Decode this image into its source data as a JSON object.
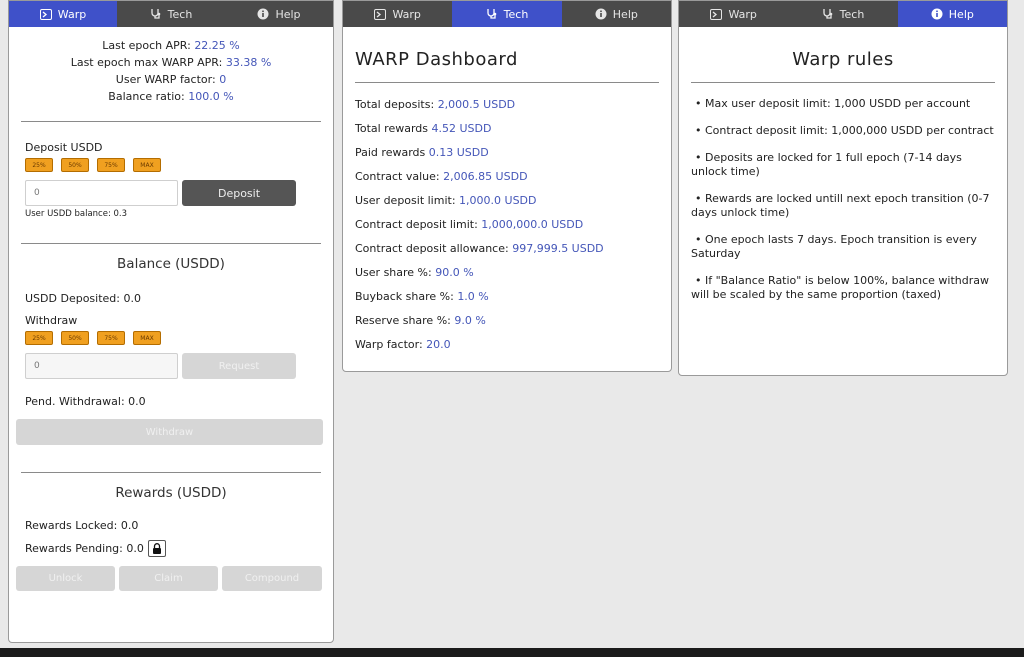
{
  "tabs": [
    {
      "label": "Warp",
      "icon": "rocket-icon"
    },
    {
      "label": "Tech",
      "icon": "stethoscope-icon"
    },
    {
      "label": "Help",
      "icon": "info-icon"
    }
  ],
  "warp": {
    "stats": {
      "last_apr_label": "Last epoch APR:",
      "last_apr_value": "22.25 %",
      "max_apr_label": "Last epoch max WARP APR:",
      "max_apr_value": "33.38 %",
      "warp_factor_label": "User WARP factor:",
      "warp_factor_value": "0",
      "balance_ratio_label": "Balance ratio:",
      "balance_ratio_value": "100.0 %"
    },
    "deposit": {
      "label": "Deposit USDD",
      "percent_buttons": [
        "25%",
        "50%",
        "75%",
        "MAX"
      ],
      "input_value": "0",
      "button": "Deposit",
      "balance_text": "User USDD balance: 0.3"
    },
    "balance": {
      "title": "Balance (USDD)",
      "deposited_text": "USDD Deposited: 0.0",
      "withdraw_label": "Withdraw",
      "percent_buttons": [
        "25%",
        "50%",
        "75%",
        "MAX"
      ],
      "input_value": "0",
      "request_button": "Request",
      "pending_text": "Pend. Withdrawal: 0.0",
      "withdraw_button": "Withdraw"
    },
    "rewards": {
      "title": "Rewards (USDD)",
      "locked_text": "Rewards Locked: 0.0",
      "pending_text": "Rewards Pending: 0.0",
      "unlock_button": "Unlock",
      "claim_button": "Claim",
      "compound_button": "Compound"
    }
  },
  "dashboard": {
    "title": "WARP Dashboard",
    "rows": [
      {
        "label": "Total deposits:",
        "value": "2,000.5 USDD"
      },
      {
        "label": "Total rewards",
        "value": "4.52 USDD"
      },
      {
        "label": "Paid rewards",
        "value": "0.13 USDD"
      },
      {
        "label": "Contract value:",
        "value": "2,006.85 USDD"
      },
      {
        "label": "User deposit limit:",
        "value": "1,000.0 USDD"
      },
      {
        "label": "Contract deposit limit:",
        "value": "1,000,000.0 USDD"
      },
      {
        "label": "Contract deposit allowance:",
        "value": "997,999.5 USDD"
      },
      {
        "label": "User share %:",
        "value": "90.0 %"
      },
      {
        "label": "Buyback share %:",
        "value": "1.0 %"
      },
      {
        "label": "Reserve share %:",
        "value": "9.0 %"
      },
      {
        "label": "Warp factor:",
        "value": "20.0"
      }
    ]
  },
  "rules": {
    "title": "Warp rules",
    "items": [
      "Max user deposit limit: 1,000 USDD per account",
      "Contract deposit limit: 1,000,000 USDD per contract",
      "Deposits are locked for 1 full epoch (7-14 days unlock time)",
      "Rewards are locked untill next epoch transition (0-7 days unlock time)",
      "One epoch lasts 7 days. Epoch transition is every Saturday",
      "If \"Balance Ratio\" is below 100%, balance withdraw will be scaled by the same proportion (taxed)"
    ]
  },
  "colors": {
    "tab_active": "#3f51c9",
    "tab_inactive": "#4a4a4a",
    "value_blue": "#4456b8",
    "percent_button": "#f0a020"
  }
}
